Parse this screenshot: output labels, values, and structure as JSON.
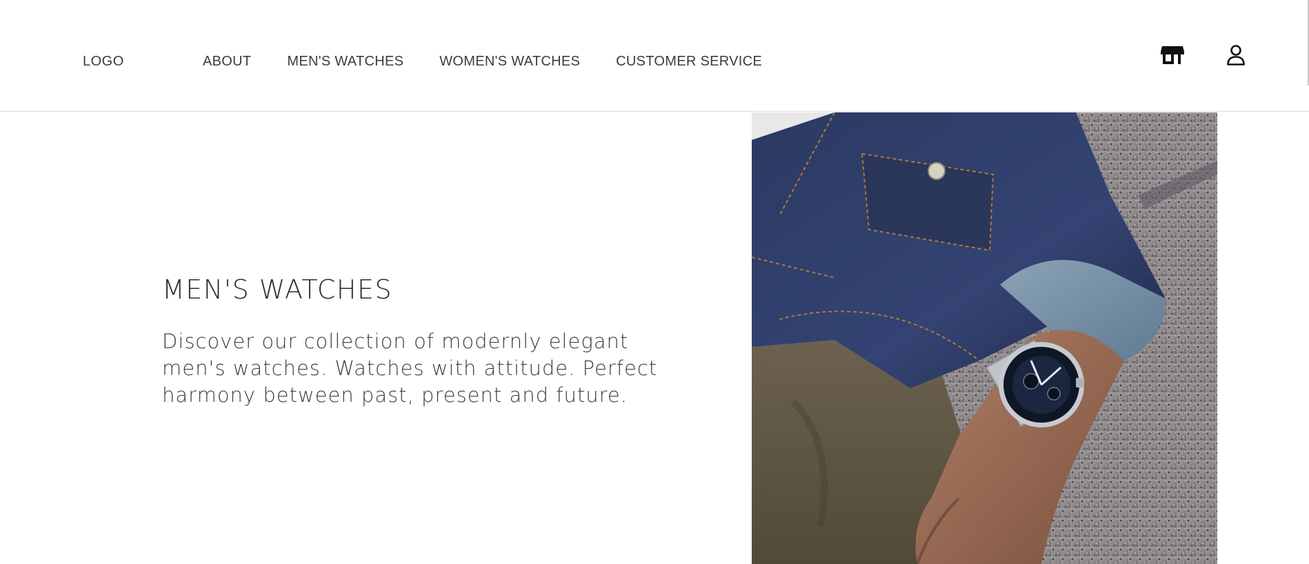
{
  "header": {
    "logo": "LOGO",
    "nav": [
      {
        "label": "ABOUT"
      },
      {
        "label": "MEN'S WATCHES"
      },
      {
        "label": "WOMEN'S WATCHES"
      },
      {
        "label": "CUSTOMER SERVICE"
      }
    ],
    "icons": [
      "store-icon",
      "user-icon"
    ]
  },
  "hero": {
    "title": "MEN'S WATCHES",
    "description": "Discover our collection of modernly elegant men's watches. Watches with attitude. Perfect harmony between past, present and future."
  },
  "colors": {
    "text": "#3c3c3c",
    "denim": "#2f3d63",
    "border": "#dcdcdc"
  }
}
